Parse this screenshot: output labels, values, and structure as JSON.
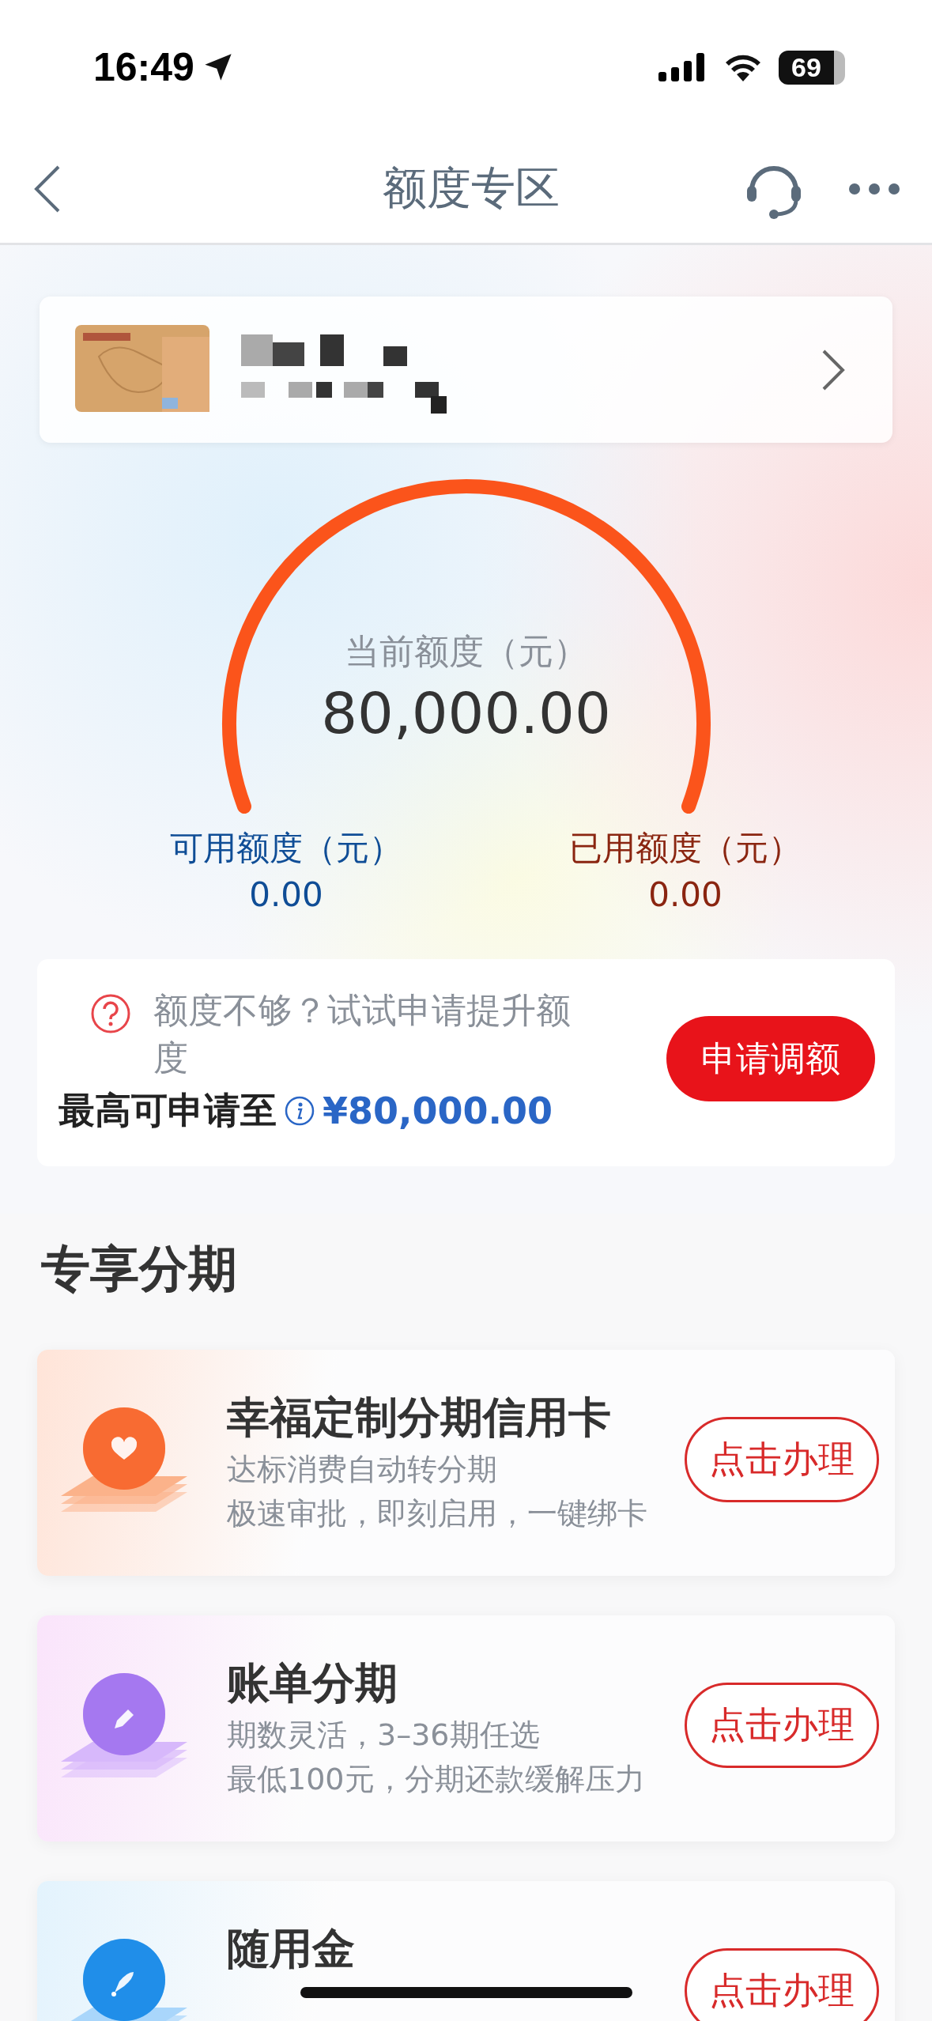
{
  "status_bar": {
    "time": "16:49",
    "battery": "69"
  },
  "nav": {
    "title": "额度专区"
  },
  "gauge": {
    "label": "当前额度（元）",
    "value": "80,000.00",
    "stats": [
      {
        "kind": "available",
        "label": "可用额度（元）",
        "value": "0.00"
      },
      {
        "kind": "used",
        "label": "已用额度（元）",
        "value": "0.00"
      }
    ]
  },
  "raise": {
    "prompt": "额度不够？试试申请提升额度",
    "max_label": "最高可申请至",
    "max_value": "¥80,000.00",
    "button": "申请调额"
  },
  "section": {
    "title": "专享分期"
  },
  "products": [
    {
      "kind": "heart",
      "title": "幸福定制分期信用卡",
      "lines": [
        "达标消费自动转分期",
        "极速审批，即刻启用，一键绑卡"
      ],
      "button": "点击办理"
    },
    {
      "kind": "pencil",
      "title": "账单分期",
      "lines": [
        "期数灵活，3–36期任选",
        "最低100元，分期还款缓解压力"
      ],
      "button": "点击办理"
    },
    {
      "kind": "rocket",
      "title": "随用金",
      "button": "点击办理"
    }
  ]
}
